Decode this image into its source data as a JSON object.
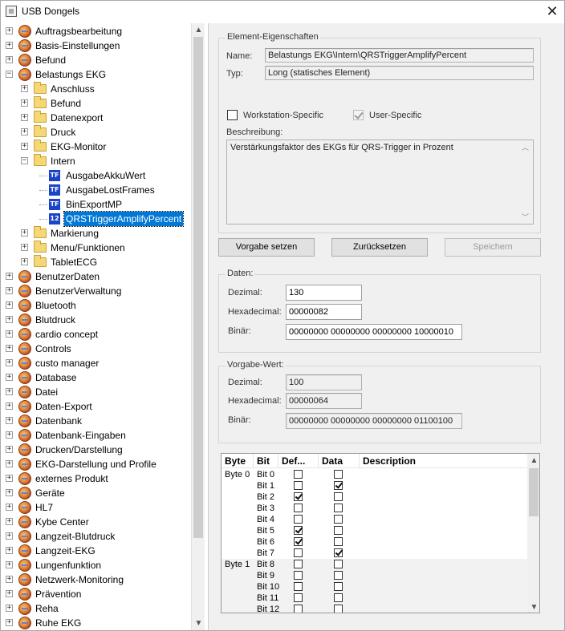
{
  "window": {
    "title": "USB Dongels",
    "close_glyph": "✕"
  },
  "tree": {
    "items": [
      {
        "label": "Auftragsbearbeitung",
        "level": 0,
        "icon": "globe-icon",
        "expander": "+"
      },
      {
        "label": "Basis-Einstellungen",
        "level": 0,
        "icon": "globe-icon",
        "expander": "+"
      },
      {
        "label": "Befund",
        "level": 0,
        "icon": "globe-icon",
        "expander": "+"
      },
      {
        "label": "Belastungs EKG",
        "level": 0,
        "icon": "globe-icon",
        "expander": "−"
      },
      {
        "label": "Anschluss",
        "level": 1,
        "icon": "folder-icon",
        "expander": "+"
      },
      {
        "label": "Befund",
        "level": 1,
        "icon": "folder-icon",
        "expander": "+"
      },
      {
        "label": "Datenexport",
        "level": 1,
        "icon": "folder-icon",
        "expander": "+"
      },
      {
        "label": "Druck",
        "level": 1,
        "icon": "folder-icon",
        "expander": "+"
      },
      {
        "label": "EKG-Monitor",
        "level": 1,
        "icon": "folder-icon",
        "expander": "+"
      },
      {
        "label": "Intern",
        "level": 1,
        "icon": "folder-icon",
        "expander": "−"
      },
      {
        "label": "AusgabeAkkuWert",
        "level": 2,
        "icon": "tf-icon",
        "icon_text": "TF",
        "expander": ""
      },
      {
        "label": "AusgabeLostFrames",
        "level": 2,
        "icon": "tf-icon",
        "icon_text": "TF",
        "expander": ""
      },
      {
        "label": "BinExportMP",
        "level": 2,
        "icon": "tf-icon",
        "icon_text": "TF",
        "expander": ""
      },
      {
        "label": "QRSTriggerAmplifyPercent",
        "level": 2,
        "icon": "integer-icon",
        "icon_text": "12",
        "expander": "",
        "selected": true
      },
      {
        "label": "Markierung",
        "level": 1,
        "icon": "folder-icon",
        "expander": "+"
      },
      {
        "label": "Menu/Funktionen",
        "level": 1,
        "icon": "folder-icon",
        "expander": "+"
      },
      {
        "label": "TabletECG",
        "level": 1,
        "icon": "folder-icon",
        "expander": "+"
      },
      {
        "label": "BenutzerDaten",
        "level": 0,
        "icon": "globe-icon",
        "expander": "+"
      },
      {
        "label": "BenutzerVerwaltung",
        "level": 0,
        "icon": "globe-icon",
        "expander": "+"
      },
      {
        "label": "Bluetooth",
        "level": 0,
        "icon": "globe-icon",
        "expander": "+"
      },
      {
        "label": "Blutdruck",
        "level": 0,
        "icon": "globe-icon",
        "expander": "+"
      },
      {
        "label": "cardio concept",
        "level": 0,
        "icon": "globe-icon",
        "expander": "+"
      },
      {
        "label": "Controls",
        "level": 0,
        "icon": "globe-icon",
        "expander": "+"
      },
      {
        "label": "custo manager",
        "level": 0,
        "icon": "globe-icon",
        "expander": "+"
      },
      {
        "label": "Database",
        "level": 0,
        "icon": "globe-icon",
        "expander": "+"
      },
      {
        "label": "Datei",
        "level": 0,
        "icon": "globe-icon",
        "expander": "+"
      },
      {
        "label": "Daten-Export",
        "level": 0,
        "icon": "globe-icon",
        "expander": "+"
      },
      {
        "label": "Datenbank",
        "level": 0,
        "icon": "globe-icon",
        "expander": "+"
      },
      {
        "label": "Datenbank-Eingaben",
        "level": 0,
        "icon": "globe-icon",
        "expander": "+"
      },
      {
        "label": "Drucken/Darstellung",
        "level": 0,
        "icon": "globe-icon",
        "expander": "+"
      },
      {
        "label": "EKG-Darstellung und Profile",
        "level": 0,
        "icon": "globe-icon",
        "expander": "+"
      },
      {
        "label": "externes Produkt",
        "level": 0,
        "icon": "globe-icon",
        "expander": "+"
      },
      {
        "label": "Geräte",
        "level": 0,
        "icon": "globe-icon",
        "expander": "+"
      },
      {
        "label": "HL7",
        "level": 0,
        "icon": "globe-icon",
        "expander": "+"
      },
      {
        "label": "Kybe Center",
        "level": 0,
        "icon": "globe-icon",
        "expander": "+"
      },
      {
        "label": "Langzeit-Blutdruck",
        "level": 0,
        "icon": "globe-icon",
        "expander": "+"
      },
      {
        "label": "Langzeit-EKG",
        "level": 0,
        "icon": "globe-icon",
        "expander": "+"
      },
      {
        "label": "Lungenfunktion",
        "level": 0,
        "icon": "globe-icon",
        "expander": "+"
      },
      {
        "label": "Netzwerk-Monitoring",
        "level": 0,
        "icon": "globe-icon",
        "expander": "+"
      },
      {
        "label": "Prävention",
        "level": 0,
        "icon": "globe-icon",
        "expander": "+"
      },
      {
        "label": "Reha",
        "level": 0,
        "icon": "globe-icon",
        "expander": "+"
      },
      {
        "label": "Ruhe EKG",
        "level": 0,
        "icon": "globe-icon",
        "expander": "+"
      }
    ],
    "scroll_up": "▲",
    "scroll_down": "▼"
  },
  "properties": {
    "legend": "Element-Eigenschaften",
    "name_label": "Name:",
    "name_value": "Belastungs EKG\\Intern\\QRSTriggerAmplifyPercent",
    "type_label": "Typ:",
    "type_value": "Long (statisches Element)",
    "workstation_label": "Workstation-Specific",
    "workstation_checked": false,
    "user_label": "User-Specific",
    "user_checked": true,
    "description_label": "Beschreibung:",
    "description_value": "Verstärkungsfaktor des EKGs für QRS-Trigger in Prozent"
  },
  "buttons": {
    "default_label": "Vorgabe setzen",
    "reset_label": "Zurücksetzen",
    "save_label": "Speichern"
  },
  "data": {
    "legend": "Daten:",
    "decimal_label": "Dezimal:",
    "decimal_value": "130",
    "hex_label": "Hexadecimal:",
    "hex_value": "00000082",
    "binary_label": "Binär:",
    "binary_value": "00000000 00000000 00000000 10000010"
  },
  "default_value": {
    "legend": "Vorgabe-Wert:",
    "decimal_label": "Dezimal:",
    "decimal_value": "100",
    "hex_label": "Hexadecimal:",
    "hex_value": "00000064",
    "binary_label": "Binär:",
    "binary_value": "00000000 00000000 00000000 01100100"
  },
  "bit_table": {
    "columns": [
      "Byte",
      "Bit",
      "Def...",
      "Data",
      "Description"
    ],
    "rows": [
      {
        "byte": "Byte 0",
        "bit": "Bit 0",
        "def": false,
        "data": false
      },
      {
        "byte": "",
        "bit": "Bit 1",
        "def": false,
        "data": true
      },
      {
        "byte": "",
        "bit": "Bit 2",
        "def": true,
        "data": false
      },
      {
        "byte": "",
        "bit": "Bit 3",
        "def": false,
        "data": false
      },
      {
        "byte": "",
        "bit": "Bit 4",
        "def": false,
        "data": false
      },
      {
        "byte": "",
        "bit": "Bit 5",
        "def": true,
        "data": false
      },
      {
        "byte": "",
        "bit": "Bit 6",
        "def": true,
        "data": false
      },
      {
        "byte": "",
        "bit": "Bit 7",
        "def": false,
        "data": true
      },
      {
        "byte": "Byte 1",
        "bit": "Bit 8",
        "def": false,
        "data": false
      },
      {
        "byte": "",
        "bit": "Bit 9",
        "def": false,
        "data": false
      },
      {
        "byte": "",
        "bit": "Bit 10",
        "def": false,
        "data": false
      },
      {
        "byte": "",
        "bit": "Bit 11",
        "def": false,
        "data": false
      },
      {
        "byte": "",
        "bit": "Bit 12",
        "def": false,
        "data": false
      }
    ],
    "scroll_up": "▲",
    "scroll_down": "▼"
  }
}
